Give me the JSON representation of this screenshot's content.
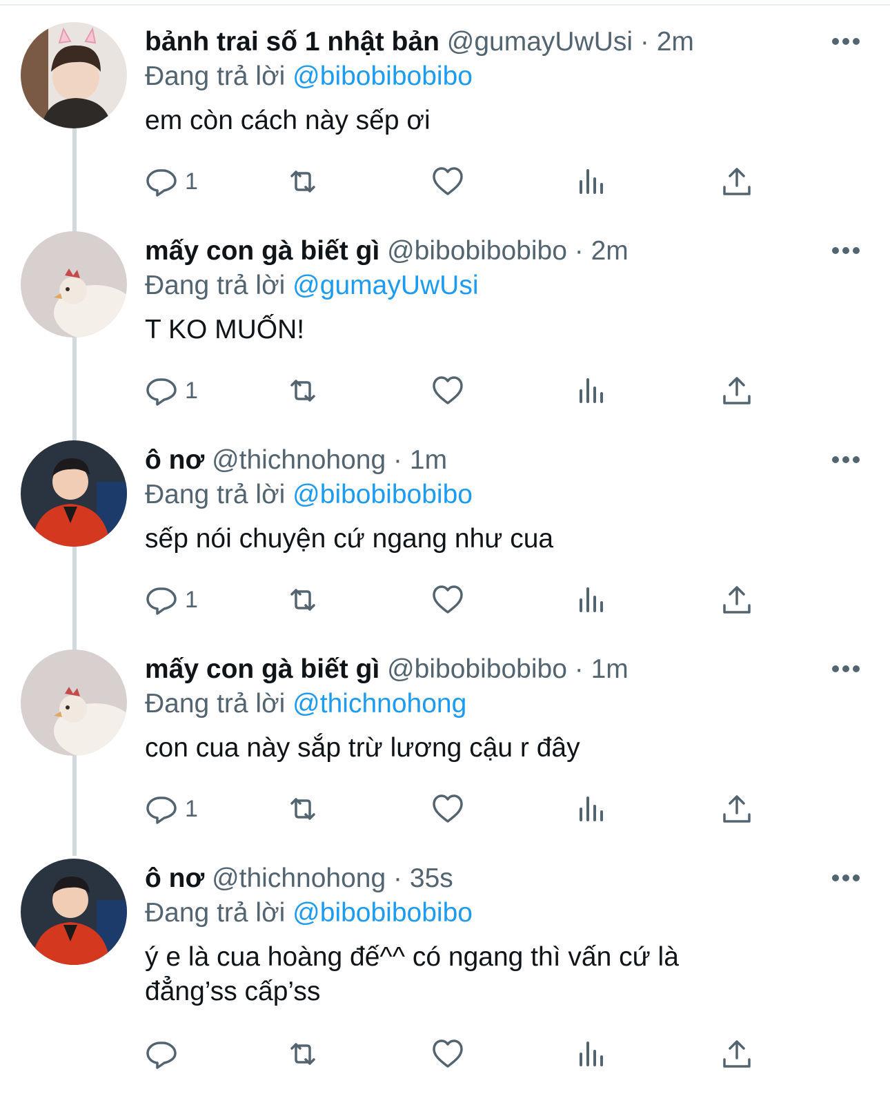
{
  "tweets": [
    {
      "name": "bảnh trai số 1 nhật bản",
      "handle": "@gumayUwUsi",
      "dot": "·",
      "time": "2m",
      "reply_prefix": "Đang trả lời",
      "reply_to": "@bibobibobibo",
      "text": "em còn cách này sếp ơi",
      "reply_count": "1",
      "avatar": "boy-with-cat-ears-photo"
    },
    {
      "name": "mấy con gà biết gì",
      "handle": "@bibobibobibo",
      "dot": "·",
      "time": "2m",
      "reply_prefix": "Đang trả lời",
      "reply_to": "@gumayUwUsi",
      "text": "T KO MUỐN!",
      "reply_count": "1",
      "avatar": "chicken-photo"
    },
    {
      "name": "ô nơ",
      "handle": "@thichnohong",
      "dot": "·",
      "time": "1m",
      "reply_prefix": "Đang trả lời",
      "reply_to": "@bibobibobibo",
      "text": "sếp nói chuyện cứ ngang như cua",
      "reply_count": "1",
      "avatar": "man-in-red-jacket-photo"
    },
    {
      "name": "mấy con gà biết gì",
      "handle": "@bibobibobibo",
      "dot": "·",
      "time": "1m",
      "reply_prefix": "Đang trả lời",
      "reply_to": "@thichnohong",
      "text": "con cua này sắp trừ lương cậu r đây",
      "reply_count": "1",
      "avatar": "chicken-photo"
    },
    {
      "name": "ô nơ",
      "handle": "@thichnohong",
      "dot": "·",
      "time": "35s",
      "reply_prefix": "Đang trả lời",
      "reply_to": "@bibobibobibo",
      "text": "ý e là cua hoàng đế^^ có ngang thì vấn cứ là đẳng’ss cấp’ss",
      "reply_count": "",
      "avatar": "man-in-red-jacket-photo"
    }
  ],
  "icons": {
    "reply": "reply-bubble-icon",
    "retweet": "retweet-icon",
    "like": "heart-icon",
    "views": "bar-chart-icon",
    "share": "share-upload-icon",
    "more": "more-dots-icon"
  },
  "colors": {
    "link": "#1d9bf0",
    "secondary_text": "#536471",
    "thread_line": "#cfd9de"
  }
}
